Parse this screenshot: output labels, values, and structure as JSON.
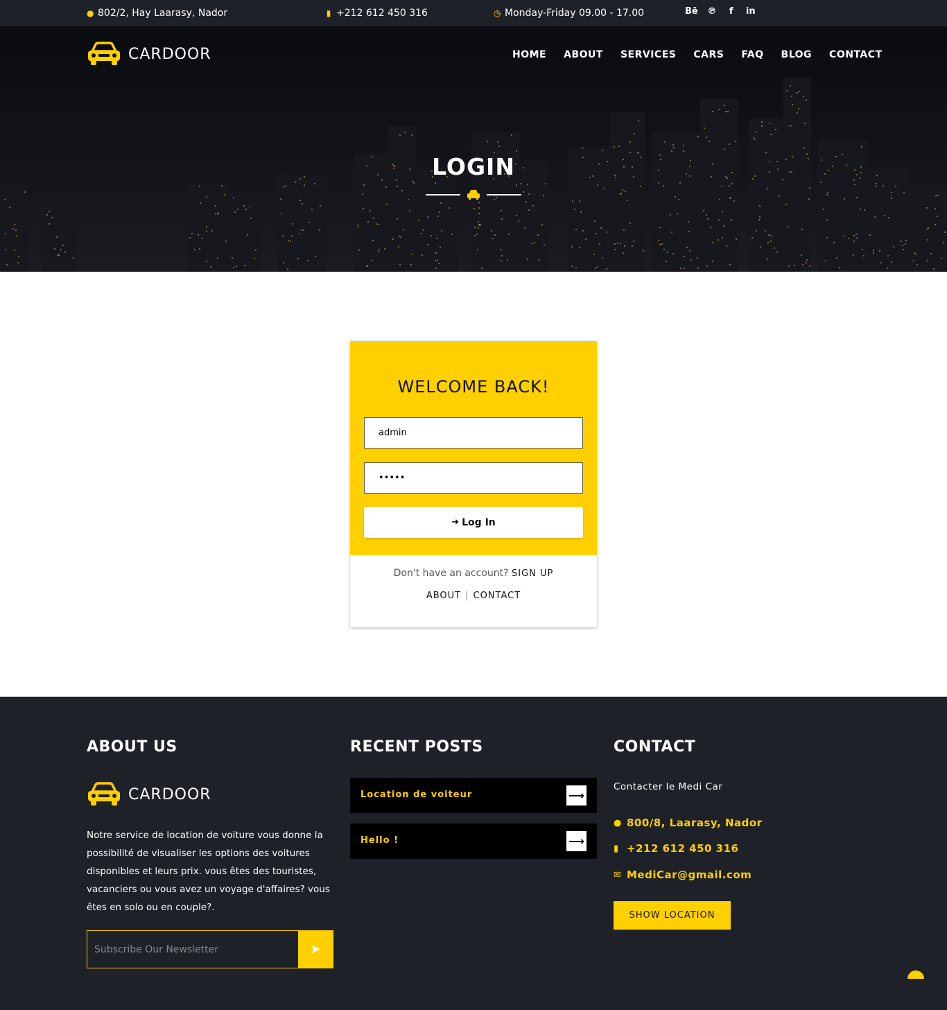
{
  "topbar": {
    "address": "802/2, Hay Laarasy, Nador",
    "phone": "+212 612 450 316",
    "hours": "Monday-Friday 09.00 - 17.00",
    "social": [
      "Bē",
      "℗",
      "f",
      "in"
    ]
  },
  "brand": {
    "name": "CARDOOR",
    "accent": "#ffd000"
  },
  "nav": [
    "HOME",
    "ABOUT",
    "SERVICES",
    "CARS",
    "FAQ",
    "BLOG",
    "CONTACT"
  ],
  "hero": {
    "title": "LOGIN"
  },
  "login": {
    "heading": "WELCOME BACK!",
    "username_value": "admin",
    "password_value": "•••••",
    "button_label": "Log In",
    "signup_prompt": "Don't have an account?",
    "signup_link": "SIGN UP",
    "about_link": "ABOUT",
    "contact_link": "CONTACT"
  },
  "footer": {
    "about_heading": "ABOUT US",
    "about_text": "Notre service de location de voiture vous donne la possibilité de visualiser les options des voitures disponibles et leurs prix. vous êtes des touristes, vacanciers ou vous avez un voyage d'affaires? vous êtes en solo ou en couple?.",
    "newsletter_placeholder": "Subscribe Our Newsletter",
    "posts_heading": "RECENT POSTS",
    "posts": [
      "Location de voiteur",
      "Hello !"
    ],
    "contact_heading": "CONTACT",
    "contact_intro": "Contacter le Medi Car",
    "contact_address": "800/8, Laarasy, Nador",
    "contact_phone": "+212 612 450 316",
    "contact_email": "MediCar@gmail.com",
    "location_button": "SHOW LOCATION"
  }
}
